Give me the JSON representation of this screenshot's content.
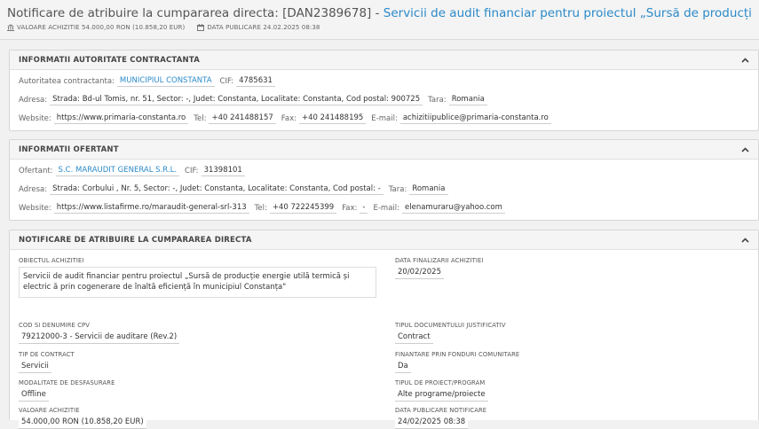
{
  "header": {
    "title_prefix": "Notificare de atribuire la cumpararea directa: [DAN2389678] - ",
    "title_link": "Servicii de audit financiar pentru proiectul „Sursă de producție energie u..",
    "valoare": "VALOARE ACHIZITIE 54.000,00 RON (10.858,20 EUR)",
    "data_publicare": "DATA PUBLICARE 24.02.2025 08:38"
  },
  "autoritate": {
    "title": "INFORMATII AUTORITATE CONTRACTANTA",
    "name_label": "Autoritatea contractanta:",
    "name": "MUNICIPIUL CONSTANTA",
    "cif_label": "CIF:",
    "cif": "4785631",
    "adresa_label": "Adresa:",
    "adresa": "Strada: Bd-ul Tomis, nr. 51, Sector: -, Judet: Constanta, Localitate: Constanta, Cod postal: 900725",
    "tara_label": "Tara:",
    "tara": "Romania",
    "website_label": "Website:",
    "website": "https://www.primaria-constanta.ro",
    "tel_label": "Tel:",
    "tel": "+40 241488157",
    "fax_label": "Fax:",
    "fax": "+40 241488195",
    "email_label": "E-mail:",
    "email": "achizitiipublice@primaria-constanta.ro"
  },
  "ofertant": {
    "title": "INFORMATII OFERTANT",
    "name_label": "Ofertant:",
    "name": "S.C. MARAUDIT GENERAL S.R.L.",
    "cif_label": "CIF:",
    "cif": "31398101",
    "adresa_label": "Adresa:",
    "adresa": "Strada: Corbului , Nr. 5, Sector: -, Judet: Constanta, Localitate: Constanta, Cod postal: -",
    "tara_label": "Tara:",
    "tara": "Romania",
    "website_label": "Website:",
    "website": "https://www.listafirme.ro/maraudit-general-srl-313",
    "tel_label": "Tel:",
    "tel": "+40 722245399",
    "fax_label": "Fax:",
    "fax": "-",
    "email_label": "E-mail:",
    "email": "elenamuraru@yahoo.com"
  },
  "notificare": {
    "title": "NOTIFICARE DE ATRIBUIRE LA CUMPARAREA DIRECTA",
    "obiect_label": "OBIECTUL ACHIZITIEI",
    "obiect": "Servicii de audit financiar pentru proiectul „Sursă de producție energie utilă termică și electric ă prin cogenerare de înaltă eficiență în municipiul Constanța\"",
    "data_finalizarii_label": "DATA FINALIZARII ACHIZITIEI",
    "data_finalizarii": "20/02/2025",
    "cpv_label": "COD SI DENUMIRE CPV",
    "cpv": "79212000-3 - Servicii de auditare (Rev.2)",
    "tip_document_label": "TIPUL DOCUMENTULUI JUSTIFICATIV",
    "tip_document": "Contract",
    "tip_contract_label": "TIP DE CONTRACT",
    "tip_contract": "Servicii",
    "finantare_label": "FINANTARE PRIN FONDURI COMUNITARE",
    "finantare": "Da",
    "modalitate_label": "MODALITATE DE DESFASURARE",
    "modalitate": "Offline",
    "tip_proiect_label": "TIPUL DE PROIECT/PROGRAM",
    "tip_proiect": "Alte programe/proiecte",
    "valoare_label": "VALOARE ACHIZITIE",
    "valoare": "54.000,00 RON (10.858,20 EUR)",
    "data_publicare_label": "DATA PUBLICARE NOTIFICARE",
    "data_publicare": "24/02/2025 08:38"
  }
}
